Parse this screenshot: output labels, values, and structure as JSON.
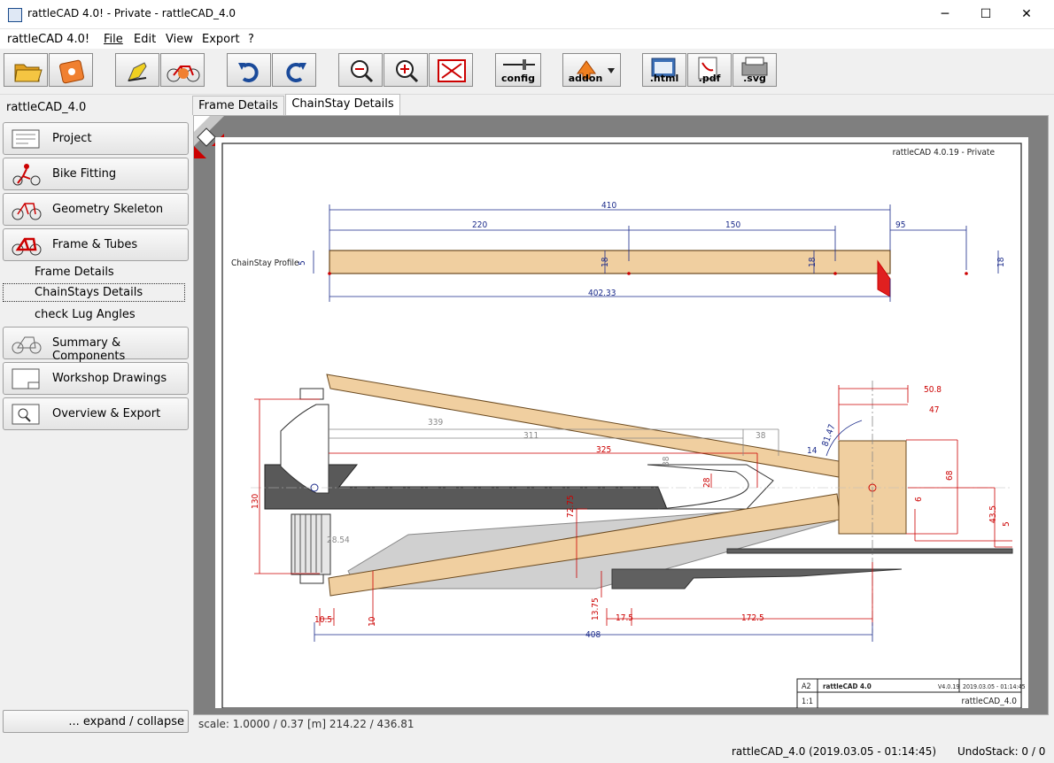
{
  "window": {
    "title": "rattleCAD 4.0! - Private  - rattleCAD_4.0",
    "minimize": "─",
    "maximize": "☐",
    "close": "✕"
  },
  "menu": [
    "rattleCAD 4.0!",
    "File",
    "Edit",
    "View",
    "Export",
    "?"
  ],
  "toolbar": {
    "config": "config",
    "addon": "addon",
    "html": ".html",
    "pdf": ".pdf",
    "svg": ".svg"
  },
  "sidebar": {
    "project_label": "rattleCAD_4.0",
    "buttons": [
      "Project",
      "Bike Fitting",
      "Geometry Skeleton",
      "Frame & Tubes",
      "Summary & Components",
      "Workshop Drawings",
      "Overview & Export"
    ],
    "subitems": [
      "Frame Details",
      "ChainStays Details",
      "check Lug Angles"
    ],
    "expand": "... expand / collapse"
  },
  "tabs": [
    "Frame Details",
    "ChainStay Details"
  ],
  "drawing": {
    "header_tag": "rattleCAD 4.0.19 - Private",
    "profile_label": "ChainStay Profile",
    "profile_dims": {
      "total_top": "410",
      "seg1": "220",
      "seg2": "150",
      "seg3": "95",
      "bottom": "402.33",
      "h1": "5",
      "h2": "18",
      "h3": "18",
      "h4": "18"
    },
    "plan_dims": {
      "d339": "339",
      "d311": "311",
      "d325": "325",
      "d38a": "38",
      "d38b": "38",
      "d14": "14",
      "d28": "28",
      "d7275": "72.75",
      "d130": "130",
      "d2854": "28.54",
      "d1375": "13.75",
      "d175": "17.5",
      "d1725": "172.5",
      "d105": "10.5",
      "d10": "10",
      "d408": "408",
      "d508": "50.8",
      "d47": "47",
      "d68": "68",
      "d6": "6",
      "d435": "43.5",
      "d5": "5",
      "ang": "81.47"
    },
    "titleblock": {
      "format": "A2",
      "scale": "1:1",
      "logo": "rattleCAD 4.0",
      "version": "V4.0.19",
      "date": "2019.03.05 - 01:14:45",
      "name": "rattleCAD_4.0"
    }
  },
  "scale_bar": "scale: 1.0000 / 0.37  [m]  214.22 / 436.81",
  "status": {
    "left": "rattleCAD_4.0 (2019.03.05 - 01:14:45)",
    "right": "UndoStack:  0  /  0"
  }
}
